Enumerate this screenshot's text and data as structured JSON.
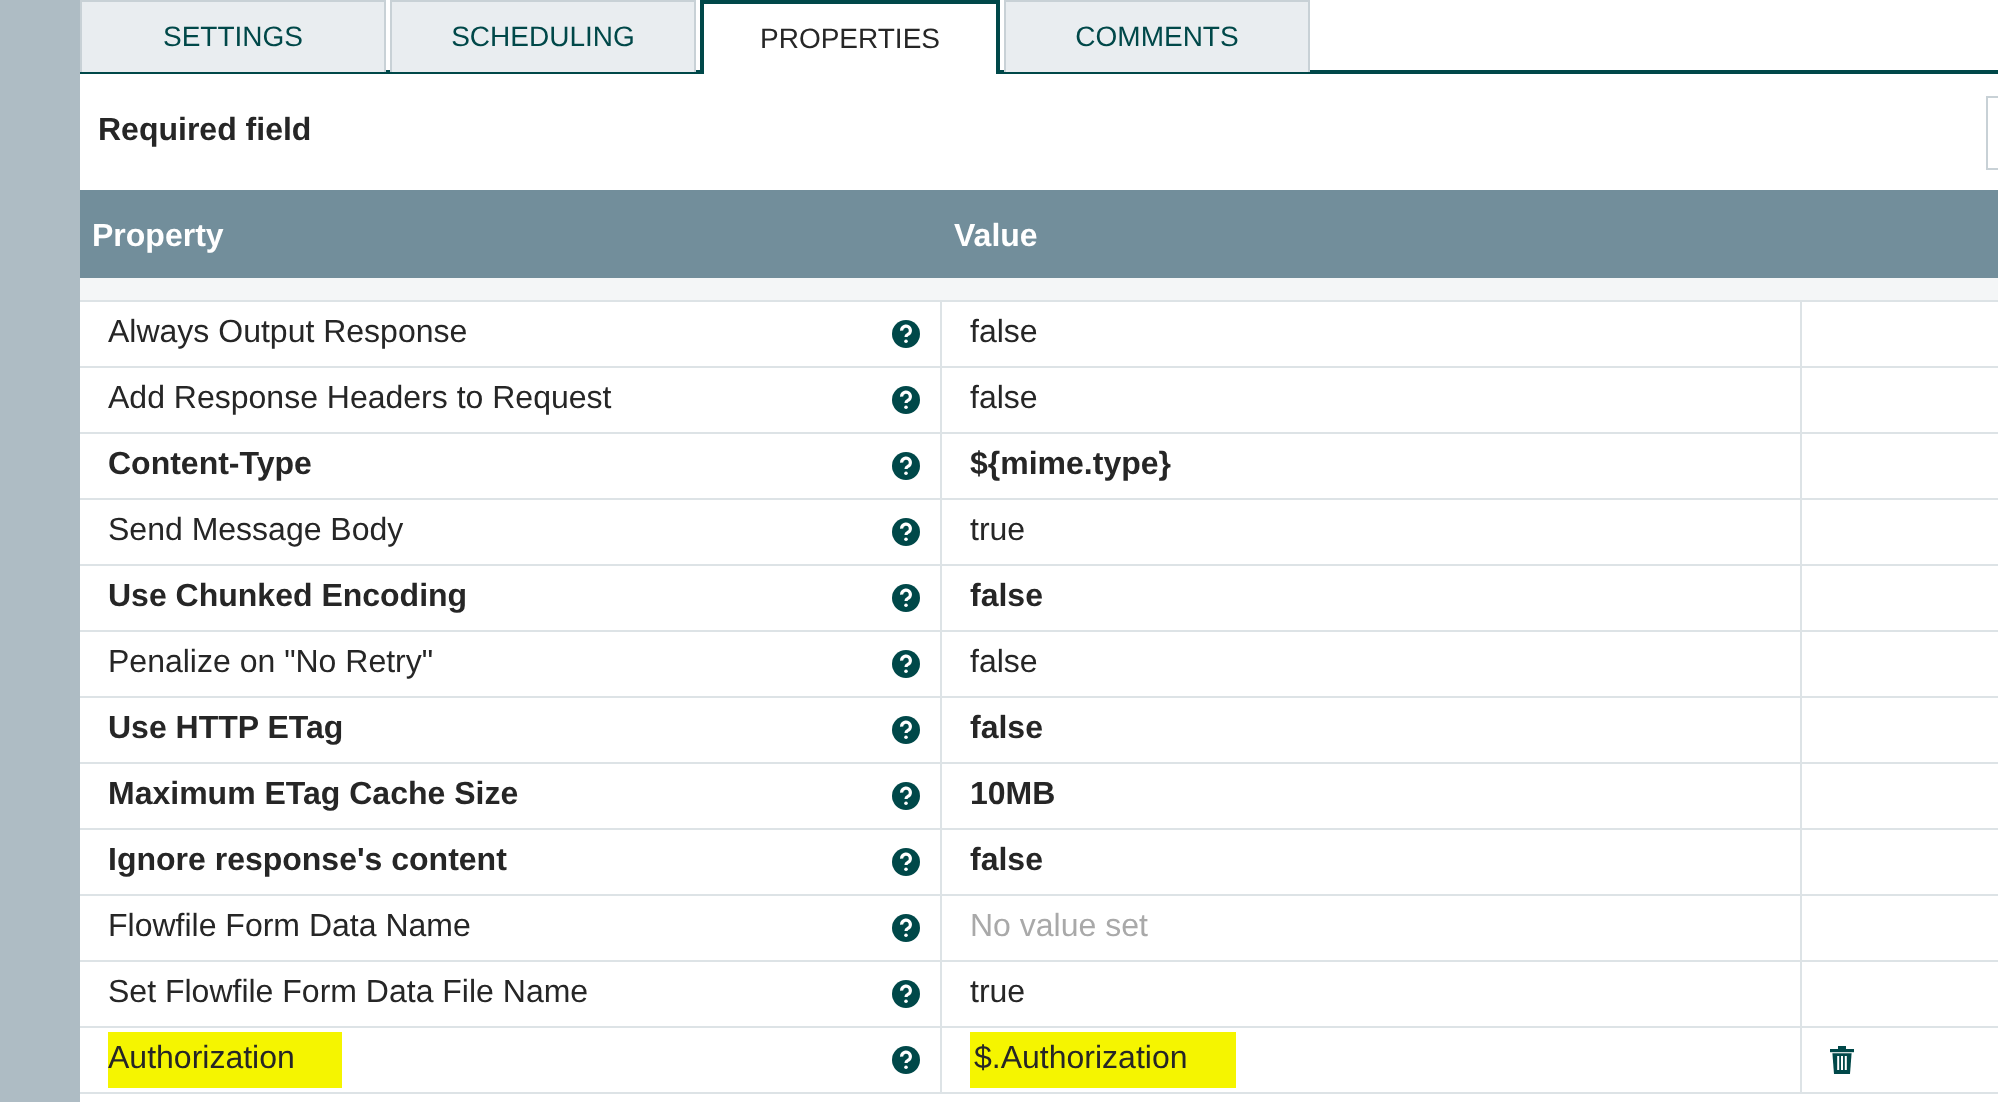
{
  "tabs": [
    {
      "label": "SETTINGS",
      "selected": false
    },
    {
      "label": "SCHEDULING",
      "selected": false
    },
    {
      "label": "PROPERTIES",
      "selected": true
    },
    {
      "label": "COMMENTS",
      "selected": false
    }
  ],
  "required_note": "Required field",
  "table": {
    "columns": [
      "Property",
      "Value"
    ],
    "rows": [
      {
        "property": "Always Output Response",
        "value": "false",
        "required": false,
        "value_set": true,
        "highlighted": false,
        "deletable": false
      },
      {
        "property": "Add Response Headers to Request",
        "value": "false",
        "required": false,
        "value_set": true,
        "highlighted": false,
        "deletable": false
      },
      {
        "property": "Content-Type",
        "value": "${mime.type}",
        "required": true,
        "value_set": true,
        "highlighted": false,
        "deletable": false
      },
      {
        "property": "Send Message Body",
        "value": "true",
        "required": false,
        "value_set": true,
        "highlighted": false,
        "deletable": false
      },
      {
        "property": "Use Chunked Encoding",
        "value": "false",
        "required": true,
        "value_set": true,
        "highlighted": false,
        "deletable": false
      },
      {
        "property": "Penalize on \"No Retry\"",
        "value": "false",
        "required": false,
        "value_set": true,
        "highlighted": false,
        "deletable": false
      },
      {
        "property": "Use HTTP ETag",
        "value": "false",
        "required": true,
        "value_set": true,
        "highlighted": false,
        "deletable": false
      },
      {
        "property": "Maximum ETag Cache Size",
        "value": "10MB",
        "required": true,
        "value_set": true,
        "highlighted": false,
        "deletable": false
      },
      {
        "property": "Ignore response's content",
        "value": "false",
        "required": true,
        "value_set": true,
        "highlighted": false,
        "deletable": false
      },
      {
        "property": "Flowfile Form Data Name",
        "value": "No value set",
        "required": false,
        "value_set": false,
        "highlighted": false,
        "deletable": false
      },
      {
        "property": "Set Flowfile Form Data File Name",
        "value": "true",
        "required": false,
        "value_set": true,
        "highlighted": false,
        "deletable": false
      },
      {
        "property": "Authorization",
        "value": "$.Authorization",
        "required": false,
        "value_set": true,
        "highlighted": true,
        "deletable": true
      }
    ]
  }
}
